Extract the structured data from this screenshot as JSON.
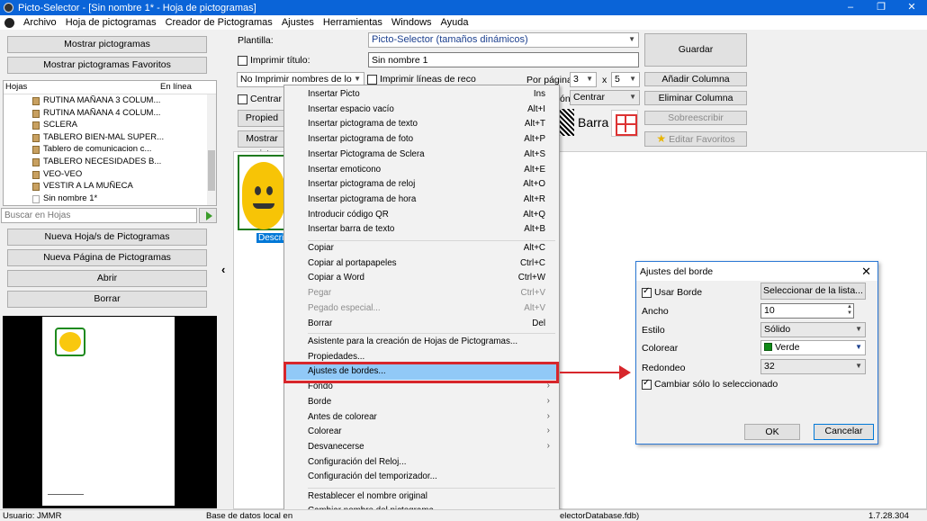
{
  "window": {
    "title": "Picto-Selector - [Sin nombre 1* - Hoja de pictogramas]",
    "minimize": "–",
    "maximize": "❐",
    "close": "✕"
  },
  "menubar": [
    "Archivo",
    "Hoja de pictogramas",
    "Creador de Pictogramas",
    "Ajustes",
    "Herramientas",
    "Windows",
    "Ayuda"
  ],
  "left": {
    "show_pictos": "Mostrar pictogramas",
    "show_fav": "Mostrar pictogramas Favoritos",
    "col_hojas": "Hojas",
    "col_online": "En línea",
    "items": [
      "RUTINA MAÑANA 3 COLUM...",
      "RUTINA MAÑANA 4 COLUM...",
      "SCLERA",
      "TABLERO BIEN-MAL SUPER...",
      "Tablero de comunicacion c...",
      "TABLERO NECESIDADES B...",
      "VEO-VEO",
      "VESTIR A LA MUÑECA",
      "Sin nombre 1*"
    ],
    "search_placeholder": "Buscar en Hojas",
    "new_sheet": "Nueva Hoja/s de Pictogramas",
    "new_page": "Nueva Página de Pictogramas",
    "open": "Abrir",
    "delete": "Borrar"
  },
  "toolbar": {
    "plantilla_label": "Plantilla:",
    "plantilla_value": "Picto-Selector (tamaños dinámicos)",
    "print_title": "Imprimir título:",
    "title_value": "Sin nombre 1",
    "no_print_names": "No Imprimir nombres de lo",
    "print_lines": "Imprimir líneas de reco",
    "per_page": "Por página",
    "cols": "3",
    "x": "x",
    "rows": "5",
    "center": "Centrar lo",
    "align_label": "ón",
    "align_value": "Centrar",
    "props": "Propied",
    "show_pict": "Mostrar pict",
    "barra": "Barra",
    "save": "Guardar",
    "add_col": "Añadir Columna",
    "del_col": "Eliminar Columna",
    "overwrite": "Sobreescribir",
    "edit_fav": "Editar Favoritos"
  },
  "picto_label": "Descrip",
  "context_menu": [
    {
      "label": "Insertar Picto",
      "key": "Ins"
    },
    {
      "label": "Insertar espacio vacío",
      "key": "Alt+I"
    },
    {
      "label": "Insertar pictograma de texto",
      "key": "Alt+T"
    },
    {
      "label": "Insertar pictograma de foto",
      "key": "Alt+P"
    },
    {
      "label": "Insertar Pictograma de Sclera",
      "key": "Alt+S"
    },
    {
      "label": "Insertar emoticono",
      "key": "Alt+E"
    },
    {
      "label": "Insertar pictograma de reloj",
      "key": "Alt+O"
    },
    {
      "label": "Insertar pictograma de hora",
      "key": "Alt+R"
    },
    {
      "label": "Introducir código QR",
      "key": "Alt+Q"
    },
    {
      "label": "Insertar barra de texto",
      "key": "Alt+B"
    },
    {
      "label": "Copiar",
      "key": "Alt+C"
    },
    {
      "label": "Copiar al portapapeles",
      "key": "Ctrl+C"
    },
    {
      "label": "Copiar a Word",
      "key": "Ctrl+W"
    },
    {
      "label": "Pegar",
      "key": "Ctrl+V"
    },
    {
      "label": "Pegado especial...",
      "key": "Alt+V"
    },
    {
      "label": "Borrar",
      "key": "Del"
    },
    {
      "label": "Asistente para la creación de Hojas de Pictogramas..."
    },
    {
      "label": "Propiedades..."
    },
    {
      "label": "Ajustes de bordes..."
    },
    {
      "label": "Fondo"
    },
    {
      "label": "Borde"
    },
    {
      "label": "Antes de colorear"
    },
    {
      "label": "Colorear"
    },
    {
      "label": "Desvanecerse"
    },
    {
      "label": "Configuración del Reloj..."
    },
    {
      "label": "Configuración del temporizador..."
    },
    {
      "label": "Restablecer el nombre original"
    },
    {
      "label": "Cambiar nombre del pictograma..."
    }
  ],
  "submenu_arrow": "›",
  "dialog": {
    "title": "Ajustes del borde",
    "use_border": "Usar Borde",
    "select_list": "Seleccionar de la lista...",
    "width_label": "Ancho",
    "width_value": "10",
    "style_label": "Estilo",
    "style_value": "Sólido",
    "color_label": "Colorear",
    "color_value": "Verde",
    "color_hex": "#0e8a16",
    "round_label": "Redondeo",
    "round_value": "32",
    "only_selected": "Cambiar sólo lo seleccionado",
    "ok": "OK",
    "cancel": "Cancelar"
  },
  "status": {
    "user": "Usuario: JMMR",
    "db": "Base de datos local en",
    "db_end": "electorDatabase.fdb)",
    "version": "1.7.28.304"
  },
  "colors": {
    "accent": "#0a64d8",
    "highlight": "#d7262b",
    "selected": "#91c9f7"
  }
}
